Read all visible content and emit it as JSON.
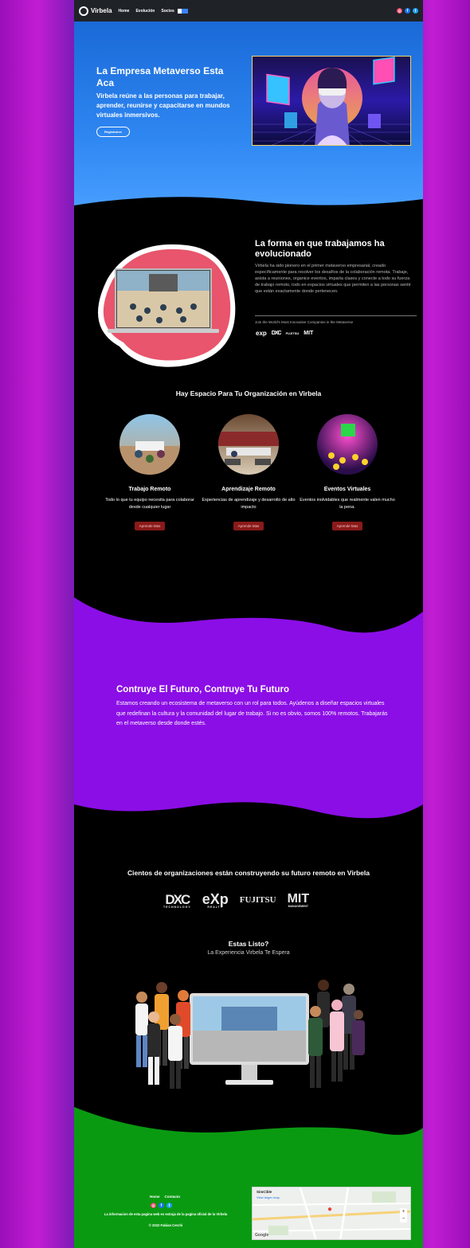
{
  "header": {
    "brand": "Virbela",
    "nav": [
      "Home",
      "Evolución",
      "Socios"
    ],
    "socials": [
      "instagram",
      "facebook",
      "twitter"
    ]
  },
  "hero": {
    "title": "La Empresa Metaverso Esta Aca",
    "subtitle": "Virbela reúne a las personas para trabajar, aprender, reunirse y capacitarse en mundos virtuales inmersivos.",
    "cta": "Registrarse"
  },
  "evolved": {
    "title": "La forma en que trabajamos ha evolucionado",
    "body": "Virbela ha sido pionero en el primer metaverso empresarial, creado específicamente para resolver los desafíos de la colaboración remota. Trabaje, asista a reuniones, organice eventos, imparta clases y conecte a todo su fuerza de trabajo remoto, todo en espacios virtuales que permiten a las personas sentir que están exactamente donde pertenecen.",
    "join": "Join the World's Most Innovative Companies in the Metaverse",
    "logos": [
      "exp",
      "DXC",
      "FUJITSU",
      "MIT"
    ]
  },
  "space": {
    "title": "Hay Espacio Para Tu Organización en Virbela",
    "cards": [
      {
        "title": "Trabajo Remoto",
        "text": "Todo lo que tu equipo necesita para colaborar desde cualquier lugar",
        "button": "Aprende Mas"
      },
      {
        "title": "Aprendizaje Remoto",
        "text": "Experiencias de aprendizaje y desarrollo de alto impacto",
        "button": "Aprende Mas"
      },
      {
        "title": "Eventos Virtuales",
        "text": "Eventos inolvidables que realmente valen mucho la pena.",
        "button": "Aprende Mas"
      }
    ]
  },
  "future": {
    "title": "Contruye El Futuro, Contruye Tu Futuro",
    "body": "Estamos creando un ecosistema de metaverso con un rol para todos. Ayúdenos a diseñar espacios virtuales que redefinan la cultura y la comunidad del lugar de trabajo. Si no es obvio, somos 100% remotos. Trabajarás en el metaverso desde donde estés."
  },
  "orgs": {
    "title": "Cientos de organizaciones están construyendo su futuro remoto en Virbela",
    "logos": [
      {
        "name": "DXC",
        "sub": "TECHNOLOGY"
      },
      {
        "name": "eXp",
        "sub": "REALTY"
      },
      {
        "name": "FUJITSU",
        "sub": ""
      },
      {
        "name": "MIT",
        "sub": "MANAGEMENT"
      }
    ]
  },
  "ready": {
    "title": "Estas Listo?",
    "subtitle": "La Experiencia Virbela Te Espera"
  },
  "footer": {
    "nav": [
      "Home",
      "Contacto"
    ],
    "info": "La informacion de esta pagina web es extraja de la pagina oficial de la Virbela",
    "copyright": "© 2022 Fabian Cerchi",
    "map": {
      "place": "SimCible",
      "link": "View larger map",
      "label": "Google"
    }
  },
  "colors": {
    "hero_blue": "#2e86f1",
    "purple": "#8b0ee6",
    "green": "#0a9a12",
    "button_red": "#8b1a1a",
    "dark": "#000000"
  }
}
